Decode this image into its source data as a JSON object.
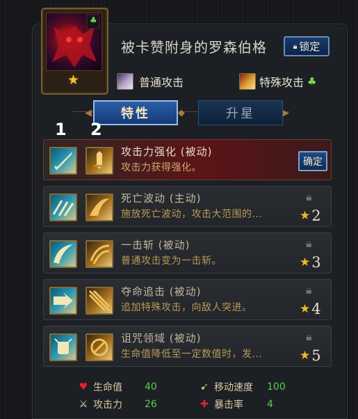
{
  "character": {
    "name": "被卡赞附身的罗森伯格",
    "star_icon": "star-icon",
    "badge_icon": "leaf-icon",
    "lock_button_label": "锁定",
    "lock_icon": "padlock-icon"
  },
  "attacks": {
    "normal": "普通攻击",
    "special": "特殊攻击"
  },
  "tabs": {
    "trait": "特性",
    "upgrade": "升星"
  },
  "column_numbers": {
    "first": "1",
    "second": "2"
  },
  "skills": [
    {
      "name": "攻击力强化 (被动)",
      "desc": "攻击力获得强化。",
      "action_label": "确定",
      "unlocked": true
    },
    {
      "name": "死亡波动 (主动)",
      "desc": "施放死亡波动，攻击大范围的...",
      "required_stars": "2",
      "unlocked": false
    },
    {
      "name": "一击斩 (被动)",
      "desc": "普通攻击变为一击斩。",
      "required_stars": "3",
      "unlocked": false
    },
    {
      "name": "夺命追击 (被动)",
      "desc": "追加特殊攻击，向敌人突进。",
      "required_stars": "4",
      "unlocked": false
    },
    {
      "name": "诅咒领域 (被动)",
      "desc": "生命值降低至一定数值时，发...",
      "required_stars": "5",
      "unlocked": false
    }
  ],
  "stats": [
    {
      "label": "生命值",
      "value": "40",
      "icon": "heart-icon"
    },
    {
      "label": "移动速度",
      "value": "100",
      "icon": "boot-icon"
    },
    {
      "label": "攻击力",
      "value": "26",
      "icon": "sword-icon"
    },
    {
      "label": "暴击率",
      "value": "4",
      "icon": "crosshair-icon"
    }
  ],
  "colors": {
    "accent_blue": "#1c4b85",
    "star_gold": "#f0b92e",
    "stat_green": "#56d04e"
  }
}
